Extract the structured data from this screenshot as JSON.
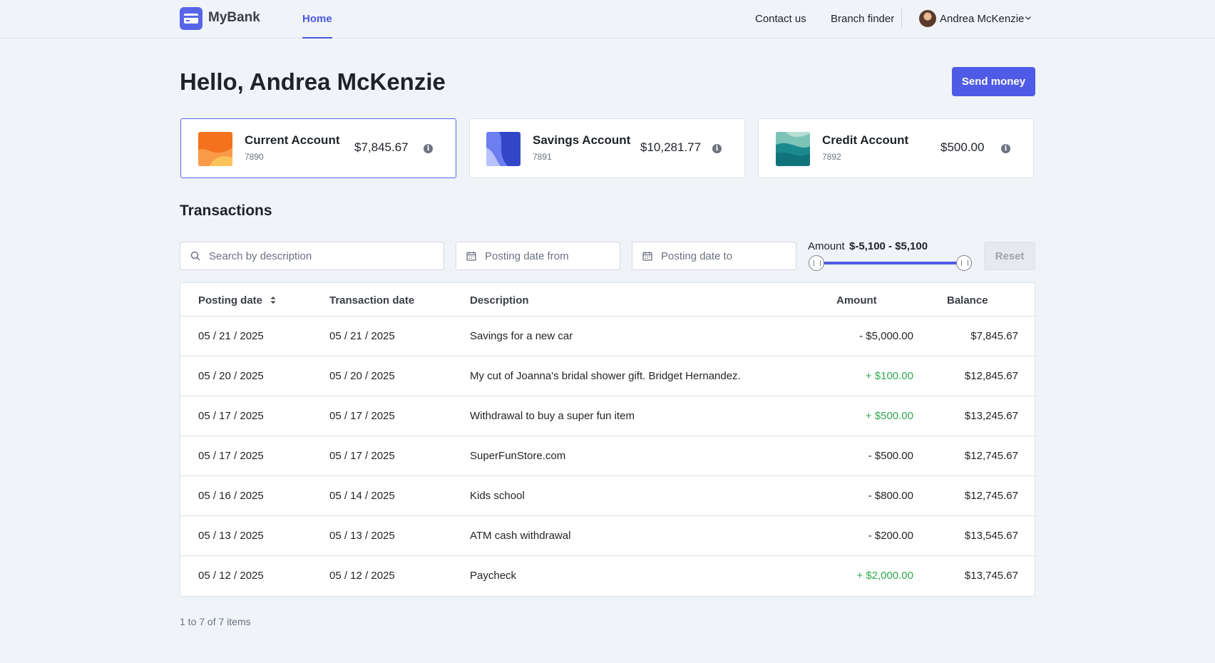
{
  "app": {
    "name": "MyBank"
  },
  "nav": {
    "home": "Home",
    "contact": "Contact us",
    "branch": "Branch finder",
    "user": "Andrea McKenzie"
  },
  "header": {
    "greeting": "Hello, Andrea McKenzie",
    "send_money": "Send money"
  },
  "accounts": [
    {
      "name": "Current Account",
      "number": "7890",
      "balance": "$7,845.67",
      "selected": true
    },
    {
      "name": "Savings Account",
      "number": "7891",
      "balance": "$10,281.77",
      "selected": false
    },
    {
      "name": "Credit Account",
      "number": "7892",
      "balance": "$500.00",
      "selected": false
    }
  ],
  "transactions": {
    "title": "Transactions",
    "search_placeholder": "Search by description",
    "date_from_placeholder": "Posting date from",
    "date_to_placeholder": "Posting date to",
    "amount_label": "Amount",
    "amount_range": "$-5,100 - $5,100",
    "reset": "Reset",
    "columns": {
      "posting": "Posting date",
      "transaction": "Transaction date",
      "description": "Description",
      "amount": "Amount",
      "balance": "Balance"
    },
    "rows": [
      {
        "posting": "05 / 21 / 2025",
        "transaction": "05 / 21 / 2025",
        "description": "Savings for a new car",
        "amount": "- $5,000.00",
        "balance": "$7,845.67"
      },
      {
        "posting": "05 / 20 / 2025",
        "transaction": "05 / 20 / 2025",
        "description": "My cut of Joanna's bridal shower gift. Bridget Hernandez.",
        "amount": "+ $100.00",
        "balance": "$12,845.67"
      },
      {
        "posting": "05 / 17 / 2025",
        "transaction": "05 / 17 / 2025",
        "description": "Withdrawal to buy a super fun item",
        "amount": "+ $500.00",
        "balance": "$13,245.67"
      },
      {
        "posting": "05 / 17 / 2025",
        "transaction": "05 / 17 / 2025",
        "description": "SuperFunStore.com",
        "amount": "- $500.00",
        "balance": "$12,745.67"
      },
      {
        "posting": "05 / 16 / 2025",
        "transaction": "05 / 14 / 2025",
        "description": "Kids school",
        "amount": "- $800.00",
        "balance": "$12,745.67"
      },
      {
        "posting": "05 / 13 / 2025",
        "transaction": "05 / 13 / 2025",
        "description": "ATM cash withdrawal",
        "amount": "- $200.00",
        "balance": "$13,545.67"
      },
      {
        "posting": "05 / 12 / 2025",
        "transaction": "05 / 12 / 2025",
        "description": "Paycheck",
        "amount": "+ $2,000.00",
        "balance": "$13,745.67"
      }
    ],
    "pager": "1 to 7 of 7 items"
  },
  "colors": {
    "accent": "#4f5be6",
    "positive": "#2fa84f",
    "background": "#f0f4f8"
  },
  "icons": {
    "logo": "card-icon",
    "search": "search-icon",
    "calendar": "calendar-icon",
    "info": "info-icon",
    "sort": "sort-icon",
    "chevron": "chevron-down-icon"
  }
}
